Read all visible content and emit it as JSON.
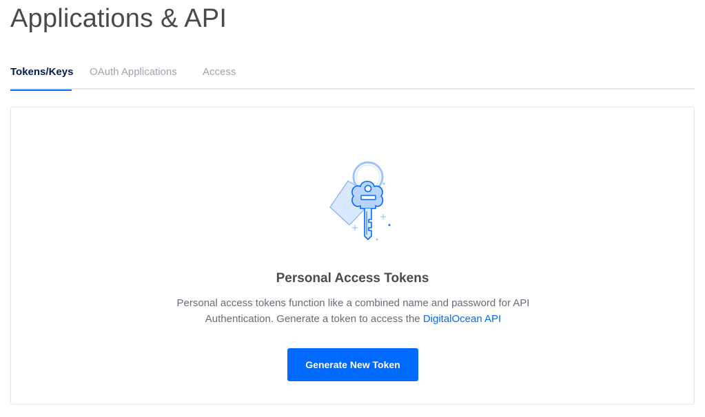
{
  "page": {
    "title": "Applications & API"
  },
  "tabs": [
    {
      "label": "Tokens/Keys",
      "active": true
    },
    {
      "label": "OAuth Applications",
      "active": false
    },
    {
      "label": "Access",
      "active": false
    }
  ],
  "empty_state": {
    "icon": "key-icon",
    "title": "Personal Access Tokens",
    "description_line1": "Personal access tokens function like a combined name and password for API",
    "description_line2_prefix": "Authentication. Generate a token to access the ",
    "link_label": "DigitalOcean API",
    "button_label": "Generate New Token"
  },
  "colors": {
    "accent": "#0069ff",
    "active_tab_text": "#031b4e",
    "inactive_tab_text": "#a0a5ad",
    "divider": "#e5e8ed"
  }
}
